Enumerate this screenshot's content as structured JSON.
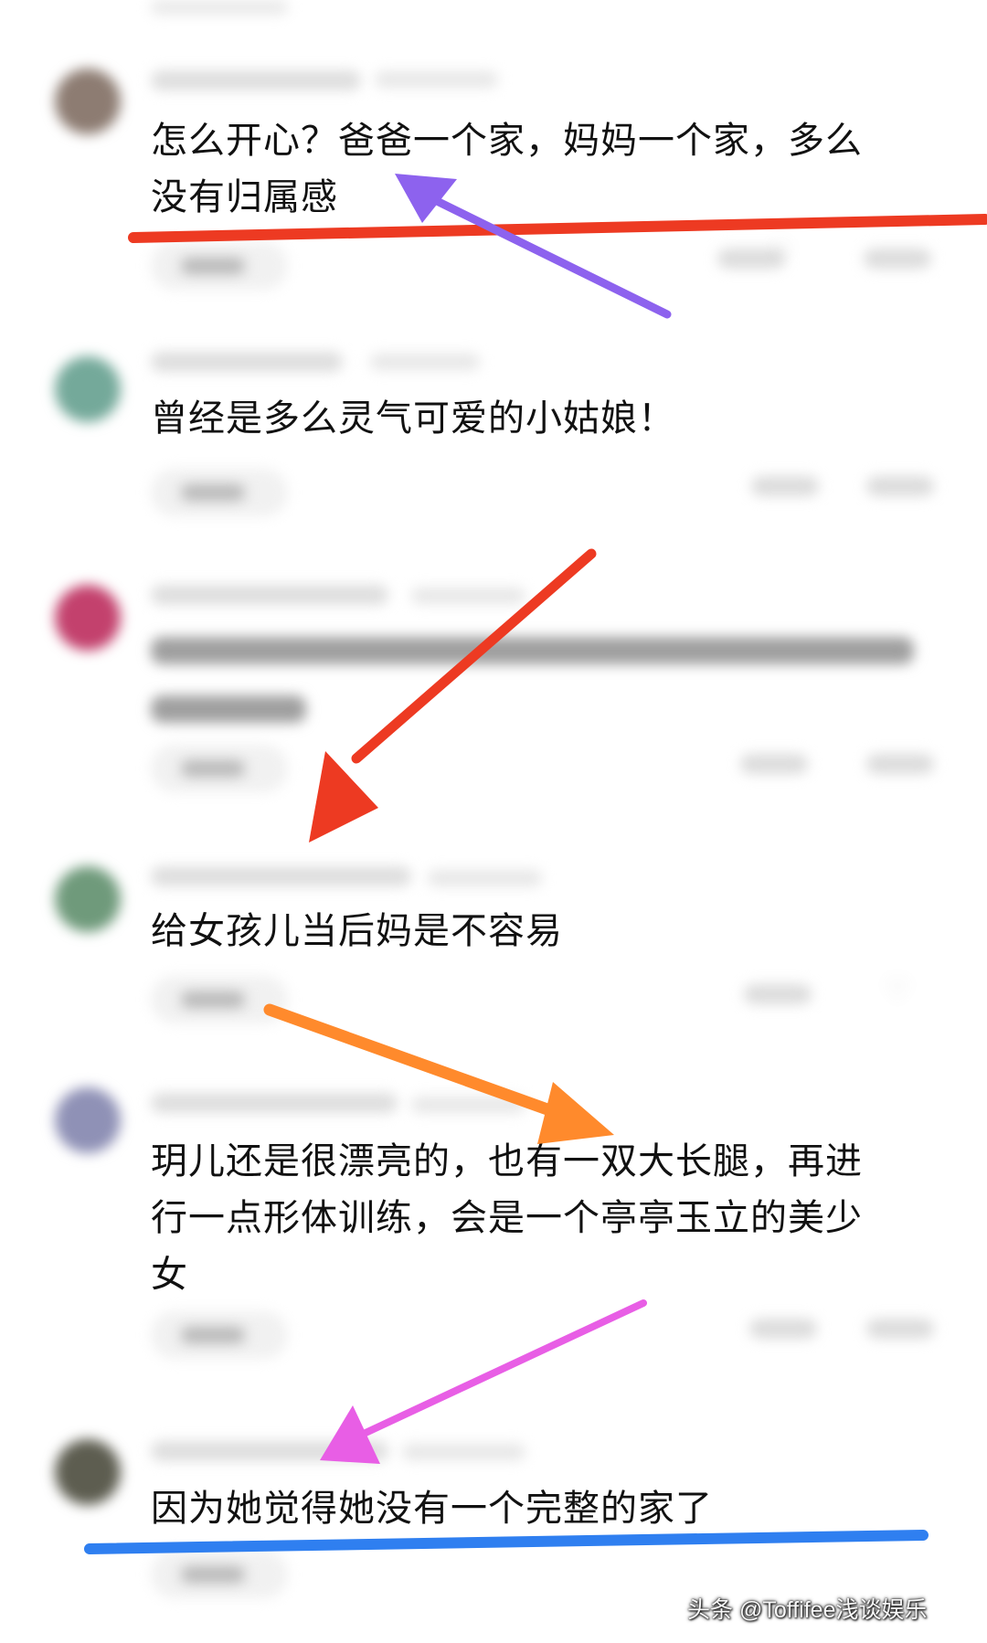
{
  "comments": [
    {
      "text": "怎么开心？爸爸一个家，妈妈一个家，多么\n没有归属感",
      "avatar_color": "#8d7c72"
    },
    {
      "text": "曾经是多么灵气可爱的小姑娘！",
      "avatar_color": "#74a99a"
    },
    {
      "text": "",
      "avatar_color": "#c3416d"
    },
    {
      "text": "给女孩儿当后妈是不容易",
      "avatar_color": "#6f9a7b"
    },
    {
      "text": "玥儿还是很漂亮的，也有一双大长腿，再进\n行一点形体训练，会是一个亭亭玉立的美少\n女",
      "avatar_color": "#8f91b6"
    },
    {
      "text": "因为她觉得她没有一个完整的家了",
      "avatar_color": "#5d5d50"
    }
  ],
  "annotations": {
    "underline_1_color": "#ed3a22",
    "underline_2_color": "#2f7ff0",
    "arrow_purple_color": "#8d62ee",
    "arrow_red_color": "#ed3a22",
    "arrow_orange_color": "#ff8a2c",
    "arrow_pink_color": "#e85ee5"
  },
  "watermark": {
    "text": "头条 @Toffifee浅谈娱乐"
  },
  "icons": {
    "like_icon": "heart-icon",
    "reply_icon": "reply-pill",
    "annotation_icon": "arrow-icon"
  }
}
